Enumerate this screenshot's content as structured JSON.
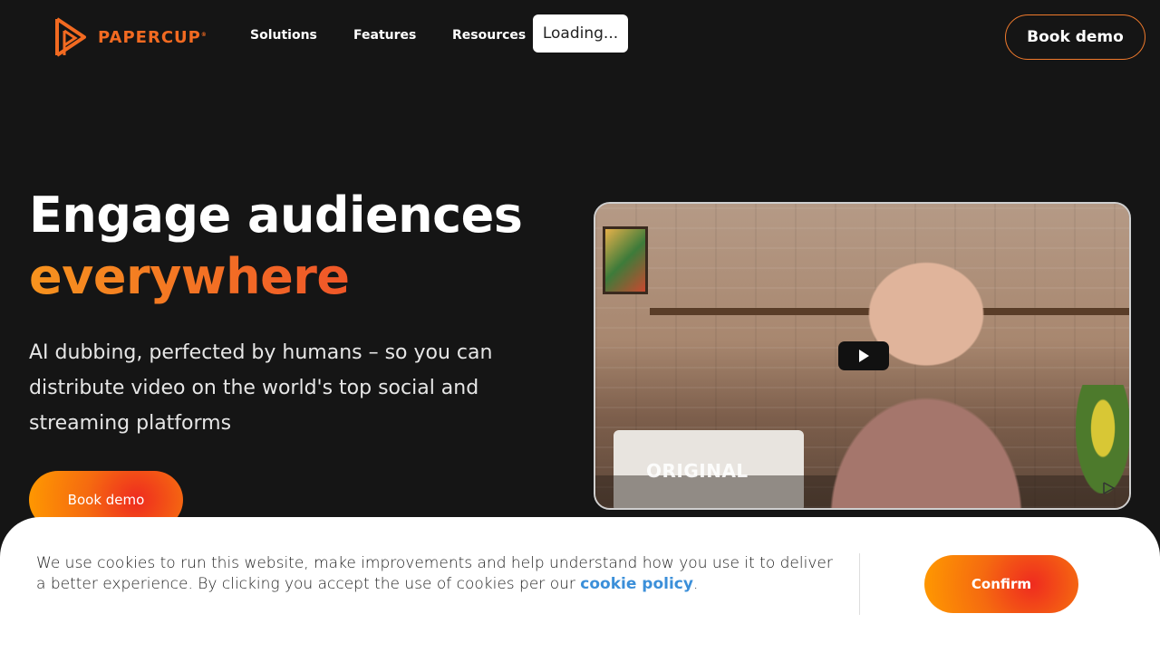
{
  "nav": {
    "logo_text": "PAPERCUP",
    "logo_mark": "®",
    "links": [
      "Solutions",
      "Features",
      "Resources"
    ],
    "loading_label": "Loading...",
    "cta_label": "Book demo"
  },
  "hero": {
    "title_line1": "Engage audiences",
    "title_line2": "everywhere",
    "subtitle": "AI dubbing, perfected by humans – so you can distribute video on the world's top social and streaming platforms",
    "cta_label": "Book demo"
  },
  "video": {
    "overlay_label": "ORIGINAL",
    "play_icon": "play-icon"
  },
  "cookie": {
    "text": "We use cookies to run this website, make improvements and help understand how you use it to deliver a better experience. By clicking you accept the use of cookies per our ",
    "link_label": "cookie policy",
    "suffix": ".",
    "confirm_label": "Confirm"
  },
  "colors": {
    "background": "#151515",
    "brand_orange": "#f26a21",
    "link_blue": "#3b8fd9"
  }
}
